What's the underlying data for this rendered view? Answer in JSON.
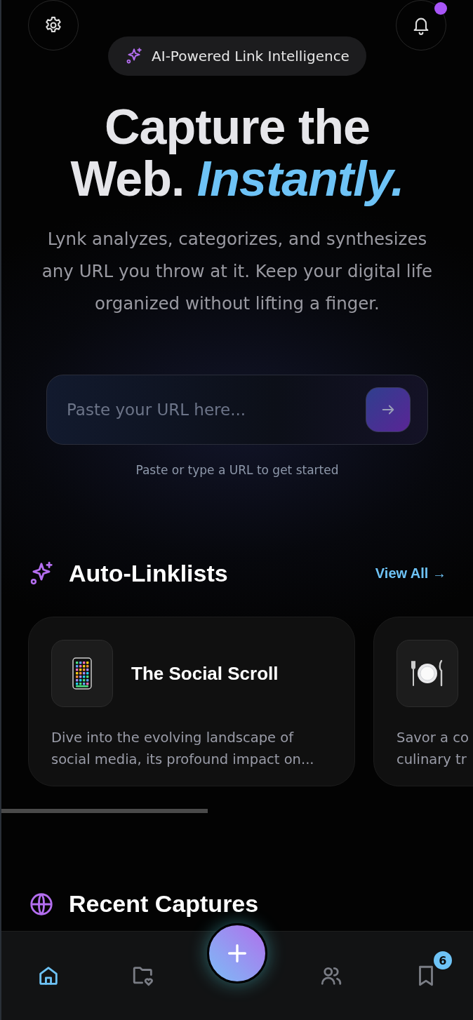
{
  "top_bar": {
    "notification_dot": true
  },
  "badge": {
    "label": "AI-Powered Link Intelligence"
  },
  "headline": {
    "line_1": "Capture the",
    "line_2_plain": "Web.",
    "line_2_accent": "Instantly."
  },
  "intro": "Lynk analyzes, categorizes, and synthesizes any URL you throw at it. Keep your digital life organized without lifting a finger.",
  "url_input": {
    "placeholder": "Paste your URL here...",
    "hint": "Paste or type a URL to get started"
  },
  "linklists": {
    "title": "Auto-Linklists",
    "view_all": "View All →",
    "cards": [
      {
        "kind": "phone",
        "title": "The Social Scroll",
        "description_lines": [
          "Dive into the evolving landscape of",
          "social media, its profound impact on..."
        ]
      },
      {
        "kind": "plate",
        "description_lines": [
          "Savor a co",
          "culinary tr"
        ]
      }
    ]
  },
  "recent": {
    "title": "Recent Captures"
  },
  "nav": {
    "items": [
      {
        "kind": "home",
        "selected": true
      },
      {
        "kind": "folder",
        "selected": false
      },
      {
        "kind": "add",
        "selected": false
      },
      {
        "kind": "users",
        "selected": false
      },
      {
        "kind": "bookmark",
        "selected": false,
        "badge": "6"
      }
    ]
  }
}
